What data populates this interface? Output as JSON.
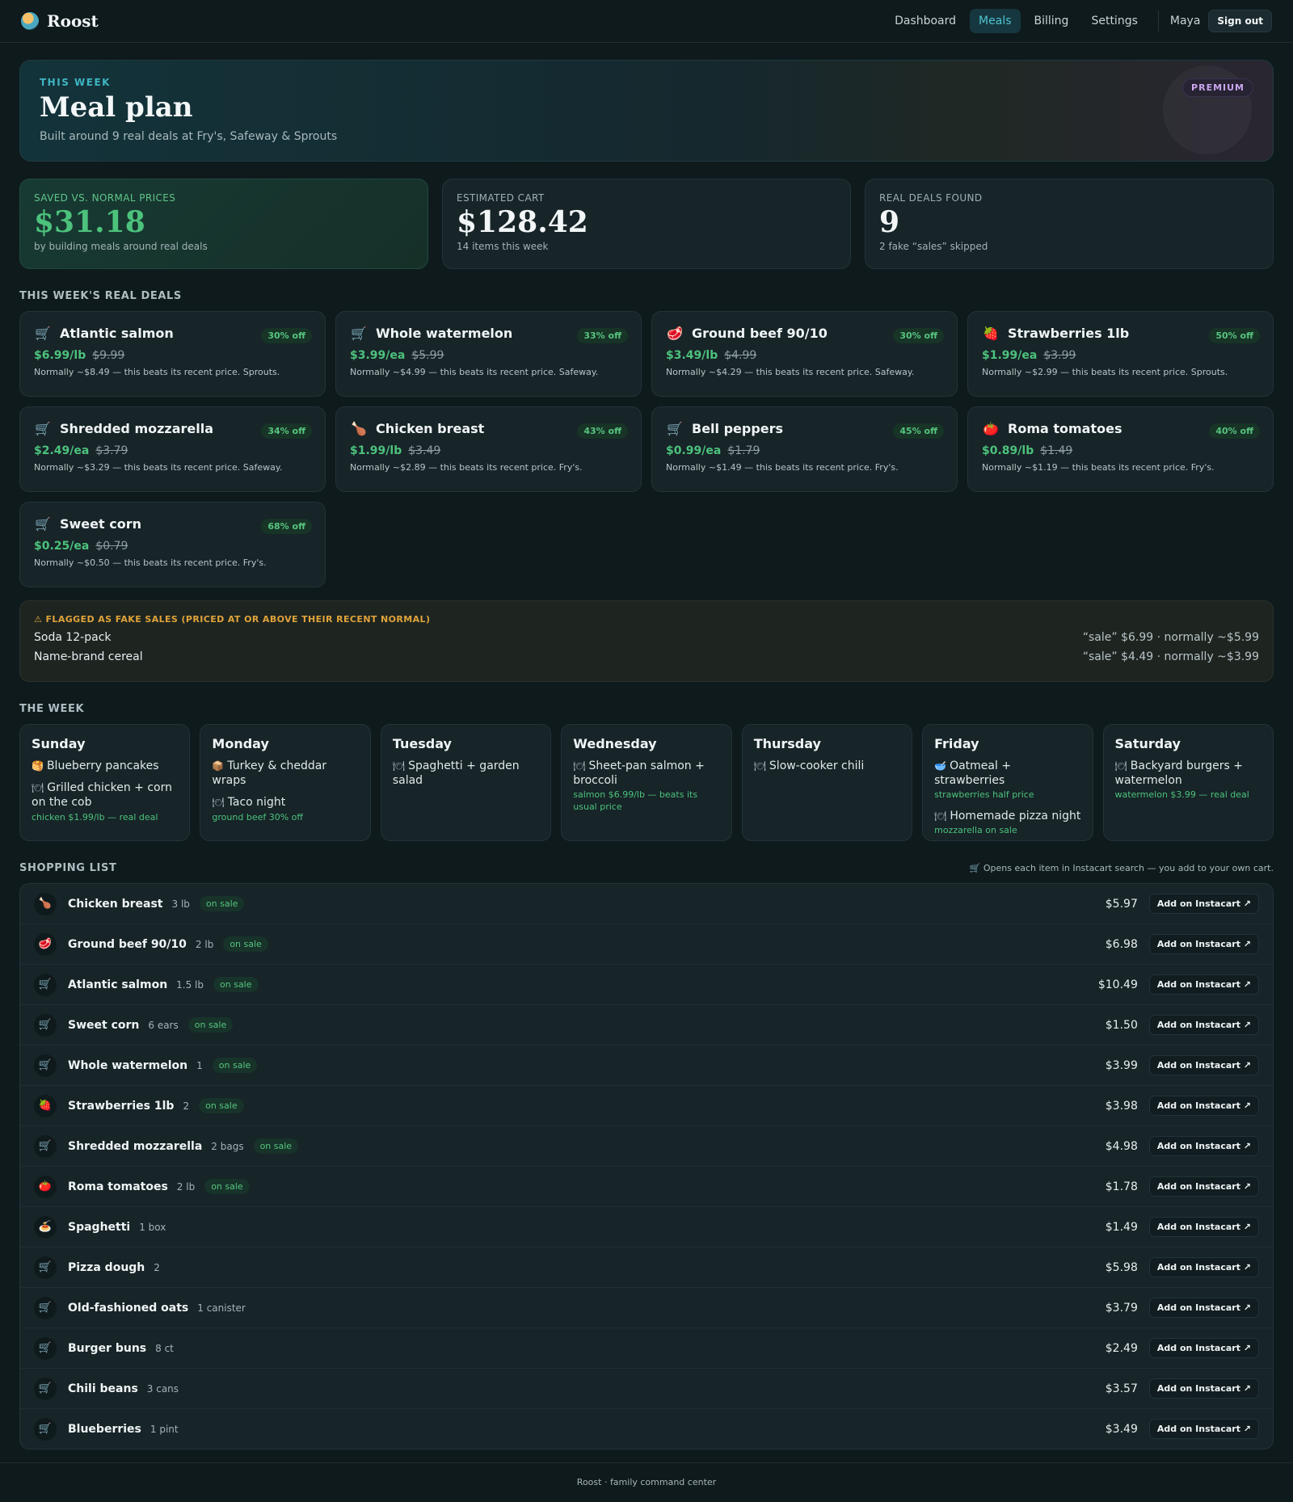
{
  "brand": {
    "name": "Roost"
  },
  "nav": {
    "items": [
      {
        "label": "Dashboard",
        "active": false
      },
      {
        "label": "Meals",
        "active": true
      },
      {
        "label": "Billing",
        "active": false
      },
      {
        "label": "Settings",
        "active": false
      }
    ],
    "user": "Maya",
    "signout_label": "Sign out"
  },
  "hero": {
    "kicker": "THIS WEEK",
    "title": "Meal plan",
    "subtitle": "Built around 9 real deals at Fry's, Safeway & Sprouts",
    "badge": "PREMIUM"
  },
  "stats": [
    {
      "label": "SAVED VS. NORMAL PRICES",
      "value": "$31.18",
      "sub": "by building meals around real deals",
      "accent": "#4cc27c"
    },
    {
      "label": "ESTIMATED CART",
      "value": "$128.42",
      "sub": "14 items this week"
    },
    {
      "label": "REAL DEALS FOUND",
      "value": "9",
      "sub": "2 fake “sales” skipped"
    }
  ],
  "deals_section": {
    "title": "THIS WEEK'S REAL DEALS"
  },
  "deals": [
    {
      "icon": "cart-icon",
      "glyph": "🛒",
      "name": "Atlantic salmon",
      "badge": "30% off",
      "price": "$6.99/lb",
      "old": "$9.99",
      "note": "Normally ~$8.49 — this beats its recent price. Sprouts."
    },
    {
      "icon": "cart-icon",
      "glyph": "🛒",
      "name": "Whole watermelon",
      "badge": "33% off",
      "price": "$3.99/ea",
      "old": "$5.99",
      "note": "Normally ~$4.99 — this beats its recent price. Safeway."
    },
    {
      "icon": "meat-icon",
      "glyph": "🥩",
      "name": "Ground beef 90/10",
      "badge": "30% off",
      "price": "$3.49/lb",
      "old": "$4.99",
      "note": "Normally ~$4.29 — this beats its recent price. Safeway."
    },
    {
      "icon": "strawberry-icon",
      "glyph": "🍓",
      "name": "Strawberries 1lb",
      "badge": "50% off",
      "price": "$1.99/ea",
      "old": "$3.99",
      "note": "Normally ~$2.99 — this beats its recent price. Sprouts."
    },
    {
      "icon": "cart-icon",
      "glyph": "🛒",
      "name": "Shredded mozzarella",
      "badge": "34% off",
      "price": "$2.49/ea",
      "old": "$3.79",
      "note": "Normally ~$3.29 — this beats its recent price. Safeway."
    },
    {
      "icon": "drumstick-icon",
      "glyph": "🍗",
      "name": "Chicken breast",
      "badge": "43% off",
      "price": "$1.99/lb",
      "old": "$3.49",
      "note": "Normally ~$2.89 — this beats its recent price. Fry's."
    },
    {
      "icon": "cart-icon",
      "glyph": "🛒",
      "name": "Bell peppers",
      "badge": "45% off",
      "price": "$0.99/ea",
      "old": "$1.79",
      "note": "Normally ~$1.49 — this beats its recent price. Fry's."
    },
    {
      "icon": "tomato-icon",
      "glyph": "🍅",
      "name": "Roma tomatoes",
      "badge": "40% off",
      "price": "$0.89/lb",
      "old": "$1.49",
      "note": "Normally ~$1.19 — this beats its recent price. Fry's."
    },
    {
      "icon": "cart-icon",
      "glyph": "🛒",
      "name": "Sweet corn",
      "badge": "68% off",
      "price": "$0.25/ea",
      "old": "$0.79",
      "note": "Normally ~$0.50 — this beats its recent price. Fry's."
    }
  ],
  "fake": {
    "title": "FLAGGED AS FAKE SALES (PRICED AT OR ABOVE THEIR RECENT NORMAL)",
    "items": [
      {
        "name": "Soda 12-pack",
        "detail": "“sale” $6.99 · normally ~$5.99"
      },
      {
        "name": "Name-brand cereal",
        "detail": "“sale” $4.49 · normally ~$3.99"
      }
    ]
  },
  "week_section": {
    "title": "THE WEEK"
  },
  "week": [
    {
      "day": "Sunday",
      "meals": [
        {
          "icon": "pancake-icon",
          "glyph": "🥞",
          "name": "Blueberry pancakes",
          "note": ""
        },
        {
          "icon": "plate-icon",
          "glyph": "🍽",
          "name": "Grilled chicken + corn on the cob",
          "note": "chicken $1.99/lb — real deal"
        }
      ]
    },
    {
      "day": "Monday",
      "meals": [
        {
          "icon": "lunchbox-icon",
          "glyph": "📦",
          "name": "Turkey & cheddar wraps",
          "note": ""
        },
        {
          "icon": "plate-icon",
          "glyph": "🍽",
          "name": "Taco night",
          "note": "ground beef 30% off"
        }
      ]
    },
    {
      "day": "Tuesday",
      "meals": [
        {
          "icon": "plate-icon",
          "glyph": "🍽",
          "name": "Spaghetti + garden salad",
          "note": ""
        }
      ]
    },
    {
      "day": "Wednesday",
      "meals": [
        {
          "icon": "plate-icon",
          "glyph": "🍽",
          "name": "Sheet-pan salmon + broccoli",
          "note": "salmon $6.99/lb — beats its usual price"
        }
      ]
    },
    {
      "day": "Thursday",
      "meals": [
        {
          "icon": "plate-icon",
          "glyph": "🍽",
          "name": "Slow-cooker chili",
          "note": ""
        }
      ]
    },
    {
      "day": "Friday",
      "meals": [
        {
          "icon": "bowl-icon",
          "glyph": "🥣",
          "name": "Oatmeal + strawberries",
          "note": "strawberries half price"
        },
        {
          "icon": "plate-icon",
          "glyph": "🍽",
          "name": "Homemade pizza night",
          "note": "mozzarella on sale"
        }
      ]
    },
    {
      "day": "Saturday",
      "meals": [
        {
          "icon": "plate-icon",
          "glyph": "🍽",
          "name": "Backyard burgers + watermelon",
          "note": "watermelon $3.99 — real deal"
        }
      ]
    }
  ],
  "shopping": {
    "title": "SHOPPING LIST",
    "tip": "🛒 Opens each item in Instacart search — you add to your own cart.",
    "button_label": "Add on Instacart ↗",
    "sale_label": "on sale",
    "items": [
      {
        "icon": "drumstick-icon",
        "glyph": "🍗",
        "name": "Chicken breast",
        "qty": "3 lb",
        "on_sale": true,
        "price": "$5.97"
      },
      {
        "icon": "meat-icon",
        "glyph": "🥩",
        "name": "Ground beef 90/10",
        "qty": "2 lb",
        "on_sale": true,
        "price": "$6.98"
      },
      {
        "icon": "cart-icon",
        "glyph": "🛒",
        "name": "Atlantic salmon",
        "qty": "1.5 lb",
        "on_sale": true,
        "price": "$10.49"
      },
      {
        "icon": "cart-icon",
        "glyph": "🛒",
        "name": "Sweet corn",
        "qty": "6 ears",
        "on_sale": true,
        "price": "$1.50"
      },
      {
        "icon": "cart-icon",
        "glyph": "🛒",
        "name": "Whole watermelon",
        "qty": "1",
        "on_sale": true,
        "price": "$3.99"
      },
      {
        "icon": "strawberry-icon",
        "glyph": "🍓",
        "name": "Strawberries 1lb",
        "qty": "2",
        "on_sale": true,
        "price": "$3.98"
      },
      {
        "icon": "cart-icon",
        "glyph": "🛒",
        "name": "Shredded mozzarella",
        "qty": "2 bags",
        "on_sale": true,
        "price": "$4.98"
      },
      {
        "icon": "tomato-icon",
        "glyph": "🍅",
        "name": "Roma tomatoes",
        "qty": "2 lb",
        "on_sale": true,
        "price": "$1.78"
      },
      {
        "icon": "spaghetti-icon",
        "glyph": "🍝",
        "name": "Spaghetti",
        "qty": "1 box",
        "on_sale": false,
        "price": "$1.49"
      },
      {
        "icon": "cart-icon",
        "glyph": "🛒",
        "name": "Pizza dough",
        "qty": "2",
        "on_sale": false,
        "price": "$5.98"
      },
      {
        "icon": "cart-icon",
        "glyph": "🛒",
        "name": "Old-fashioned oats",
        "qty": "1 canister",
        "on_sale": false,
        "price": "$3.79"
      },
      {
        "icon": "cart-icon",
        "glyph": "🛒",
        "name": "Burger buns",
        "qty": "8 ct",
        "on_sale": false,
        "price": "$2.49"
      },
      {
        "icon": "cart-icon",
        "glyph": "🛒",
        "name": "Chili beans",
        "qty": "3 cans",
        "on_sale": false,
        "price": "$3.57"
      },
      {
        "icon": "cart-icon",
        "glyph": "🛒",
        "name": "Blueberries",
        "qty": "1 pint",
        "on_sale": false,
        "price": "$3.49"
      }
    ]
  },
  "footer": "Roost · family command center"
}
